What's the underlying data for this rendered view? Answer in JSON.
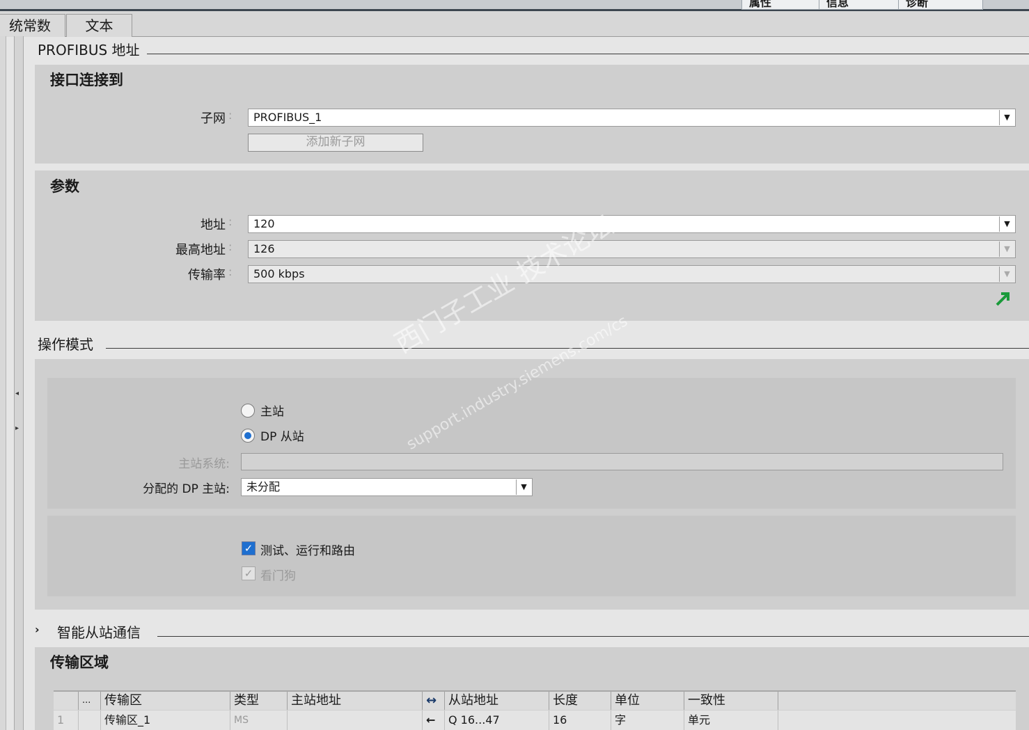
{
  "top_tabs": [
    "属性",
    "信息",
    "诊断"
  ],
  "tabs": [
    "统常数",
    "文本"
  ],
  "profibus_section": "PROFIBUS 地址",
  "interface": {
    "title": "接口连接到",
    "subnet_label": "子网",
    "subnet_value": "PROFIBUS_1",
    "add_subnet_button": "添加新子网"
  },
  "params": {
    "title": "参数",
    "address_label": "地址",
    "address_value": "120",
    "highest_label": "最高地址",
    "highest_value": "126",
    "rate_label": "传输率",
    "rate_value": "500 kbps"
  },
  "operating_mode": {
    "title": "操作模式",
    "master_label": "主站",
    "dp_slave_label": "DP 从站",
    "selected": "DP 从站",
    "master_system_label": "主站系统:",
    "master_system_value": "",
    "assigned_master_label": "分配的 DP 主站:",
    "assigned_master_value": "未分配",
    "test_label": "测试、运行和路由",
    "test_checked": true,
    "watchdog_label": "看门狗",
    "watchdog_checked": true
  },
  "smart_slave_section": "智能从站通信",
  "transfer_area": {
    "title": "传输区域",
    "columns": [
      "...",
      "传输区",
      "类型",
      "主站地址",
      "↔",
      "从站地址",
      "长度",
      "单位",
      "一致性"
    ],
    "rows": [
      {
        "num": "1",
        "name": "传输区_1",
        "type": "MS",
        "master_addr": "",
        "dir": "←",
        "slave_addr": "Q 16...47",
        "length": "16",
        "unit": "字",
        "consistency": "单元"
      }
    ]
  },
  "watermark": {
    "line1": "西门子工业  技术论坛",
    "line2": "support.industry.siemens.com/cs"
  },
  "colors": {
    "accent": "#1e6fd0",
    "go_arrow": "#1a9a3a"
  }
}
